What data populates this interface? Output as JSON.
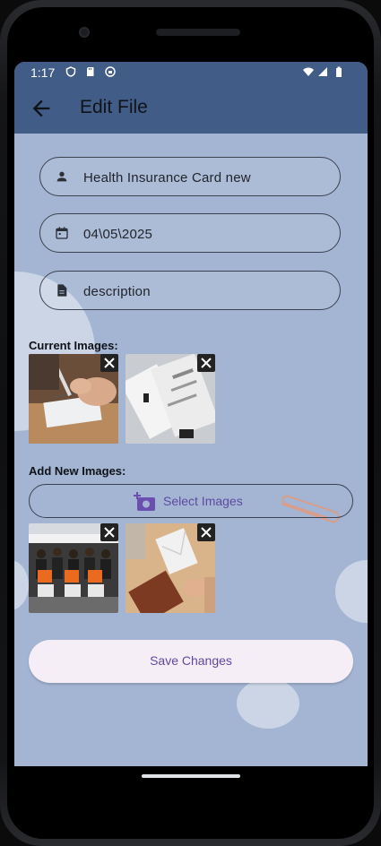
{
  "status_bar": {
    "time": "1:17"
  },
  "app_bar": {
    "title": "Edit File"
  },
  "form": {
    "name_value": "Health Insurance Card new",
    "date_value": "04\\05\\2025",
    "description_placeholder": "description"
  },
  "sections": {
    "current_images_label": "Current Images:",
    "add_new_images_label": "Add New Images:"
  },
  "buttons": {
    "select_images_label": "Select Images",
    "save_changes_label": "Save Changes"
  },
  "colors": {
    "app_bar": "#415c87",
    "background": "#a3b5d3",
    "accent": "#5f4aa1",
    "button_fill": "#f5eef7"
  },
  "icons": {
    "back": "arrow-left-icon",
    "person": "person-icon",
    "calendar": "calendar-icon",
    "document": "document-icon",
    "add_photo": "add-photo-icon",
    "close": "close-icon"
  }
}
